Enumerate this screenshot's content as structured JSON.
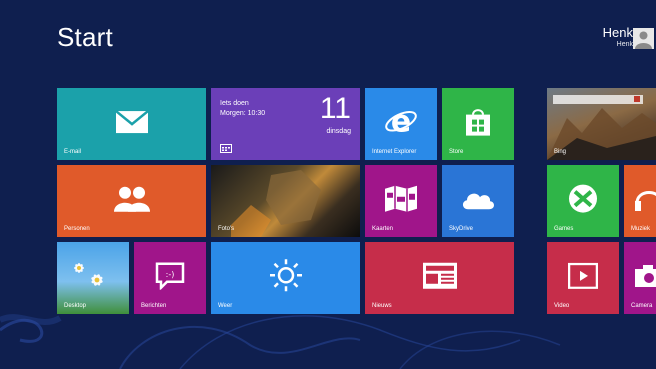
{
  "title": "Start",
  "user": {
    "name": "Henk",
    "sub": "Henk"
  },
  "colors": {
    "background": "#0f1f4f",
    "mail": "#1ba1aa",
    "calendar": "#6b3fb8",
    "ie": "#2a8ae8",
    "store": "#2fb548",
    "people": "#e05a2a",
    "maps": "#a0158a",
    "skydrive": "#2a75d6",
    "messages": "#a0158a",
    "weather": "#2a8ae8",
    "news": "#c62d4a",
    "games": "#2fb548",
    "music": "#e05a2a",
    "video": "#c62d4a",
    "camera": "#a0158a"
  },
  "tiles": {
    "mail": {
      "label": "E-mail",
      "icon": "envelope-icon"
    },
    "calendar": {
      "line1": "Iets doen",
      "line2": "Morgen: 10:30",
      "date": "11",
      "day": "dinsdag",
      "icon": "calendar-icon"
    },
    "ie": {
      "label": "Internet Explorer",
      "icon": "internet-explorer-icon"
    },
    "store": {
      "label": "Store",
      "icon": "shopping-bag-icon"
    },
    "photos": {
      "label": "Bing",
      "icon": "photo-icon"
    },
    "people": {
      "label": "Personen",
      "icon": "people-icon"
    },
    "photo_app": {
      "label": "Foto's",
      "icon": "photo-icon"
    },
    "maps": {
      "label": "Kaarten",
      "icon": "map-icon"
    },
    "skydrive": {
      "label": "SkyDrive",
      "icon": "cloud-icon"
    },
    "games": {
      "label": "Games",
      "icon": "gamepad-icon"
    },
    "music": {
      "label": "Muziek",
      "icon": "headphones-icon"
    },
    "desktop": {
      "label": "Desktop",
      "icon": "desktop-icon"
    },
    "messages": {
      "label": "Berichten",
      "icon": "chat-icon"
    },
    "weather": {
      "label": "Weer",
      "icon": "sun-icon"
    },
    "news": {
      "label": "Nieuws",
      "icon": "newspaper-icon"
    },
    "video": {
      "label": "Video",
      "icon": "play-icon"
    },
    "camera": {
      "label": "Camera",
      "icon": "camera-icon"
    }
  }
}
